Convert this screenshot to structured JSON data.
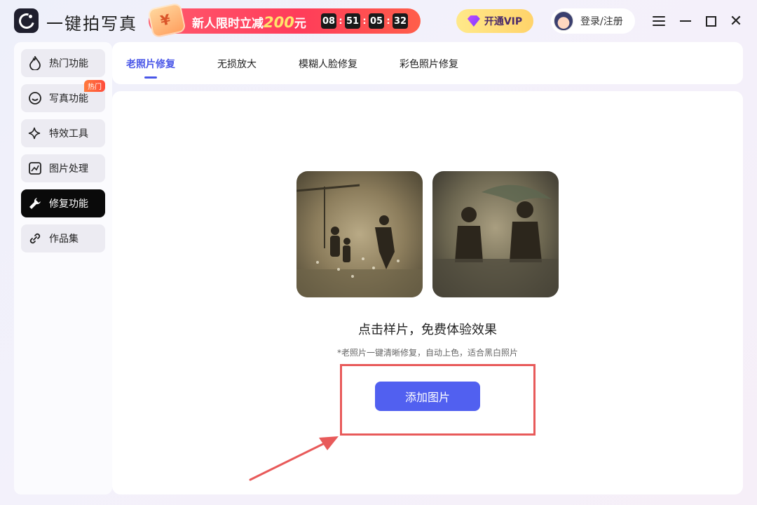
{
  "app": {
    "title": "一键拍写真"
  },
  "promo": {
    "text": "新人限时立减",
    "amount": "200",
    "unit": "元",
    "countdown": [
      "08",
      "51",
      "05",
      "32"
    ]
  },
  "header": {
    "vip_label": "开通VIP",
    "login_label": "登录/注册"
  },
  "sidebar": {
    "items": [
      {
        "label": "热门功能",
        "icon": "flame-icon"
      },
      {
        "label": "写真功能",
        "icon": "smile-icon",
        "badge": "热门"
      },
      {
        "label": "特效工具",
        "icon": "sparkle-icon"
      },
      {
        "label": "图片处理",
        "icon": "image-edit-icon"
      },
      {
        "label": "修复功能",
        "icon": "wrench-icon"
      },
      {
        "label": "作品集",
        "icon": "link-icon"
      }
    ],
    "active_index": 4
  },
  "tabs": [
    {
      "label": "老照片修复"
    },
    {
      "label": "无损放大"
    },
    {
      "label": "模糊人脸修复"
    },
    {
      "label": "彩色照片修复"
    }
  ],
  "main": {
    "title": "点击样片，免费体验效果",
    "subtitle": "*老照片一键清晰修复，自动上色，适合黑白照片",
    "add_button": "添加图片"
  },
  "colors": {
    "accent": "#4a57e8",
    "button": "#5160f0",
    "highlight": "#e85a5a",
    "promo": "#ff3c5a",
    "vip": "#ffd36a"
  }
}
